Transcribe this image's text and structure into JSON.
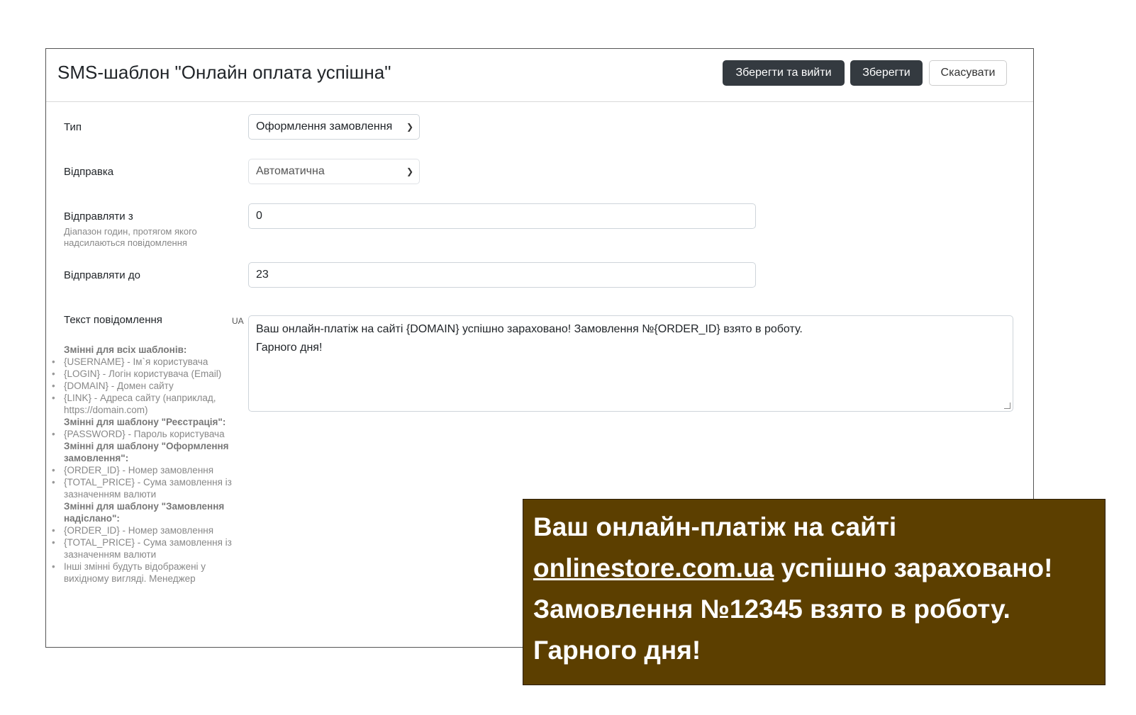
{
  "header": {
    "title": "SMS-шаблон \"Онлайн оплата успішна\"",
    "save_exit_label": "Зберегти та вийти",
    "save_label": "Зберегти",
    "cancel_label": "Скасувати"
  },
  "form": {
    "type": {
      "label": "Тип",
      "value": "Оформлення замовлення"
    },
    "sending": {
      "label": "Відправка",
      "value": "Автоматична"
    },
    "send_from": {
      "label": "Відправляти з",
      "help": "Діапазон годин, протягом якого надсилаються повідомлення",
      "value": "0"
    },
    "send_to": {
      "label": "Відправляти до",
      "value": "23"
    },
    "message": {
      "label": "Текст повідомлення",
      "lang_badge": "UA",
      "line1": "Ваш онлайн-платіж на сайті {DOMAIN} успішно зараховано! Замовлення №{ORDER_ID} взято в роботу.",
      "line2": "Гарного дня!"
    }
  },
  "variables": {
    "all_header": "Змінні для всіх шаблонів:",
    "all_items": [
      "{USERNAME} - Ім`я користувача",
      "{LOGIN} - Логін користувача (Email)",
      "{DOMAIN} - Домен сайту",
      "{LINK} - Адреса сайту (наприклад, https://domain.com)"
    ],
    "registration_header": "Змінні для шаблону \"Реєстрація\":",
    "registration_items": [
      "{PASSWORD} - Пароль користувача"
    ],
    "order_header": "Змінні для шаблону \"Оформлення замовлення\":",
    "order_items": [
      "{ORDER_ID} - Номер замовлення",
      "{TOTAL_PRICE} - Сума замовлення із зазначенням валюти"
    ],
    "shipped_header": "Змінні для шаблону \"Замовлення надіслано\":",
    "shipped_items": [
      "{ORDER_ID} - Номер замовлення",
      "{TOTAL_PRICE} - Сума замовлення із зазначенням валюти",
      "Інші змінні будуть відображені у вихідному вигляді. Менеджер"
    ]
  },
  "preview": {
    "prefix": "Ваш онлайн-платіж на сайті ",
    "domain": "onlinestore.com.ua",
    "suffix1": " успішно зараховано!",
    "line3": "Замовлення №12345 взято в роботу.",
    "line4": "Гарного дня!"
  },
  "colors": {
    "dark_button": "#343a40",
    "overlay_bg": "#5c3f00"
  }
}
